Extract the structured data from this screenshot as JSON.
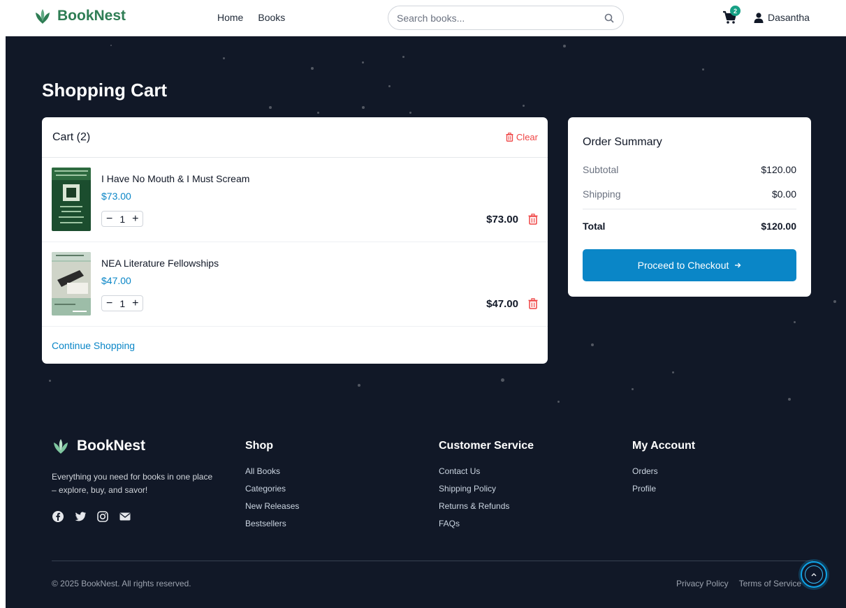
{
  "header": {
    "logo_text": "BookNest",
    "nav": [
      "Home",
      "Books"
    ],
    "search_placeholder": "Search books...",
    "cart_count": "2",
    "username": "Dasantha"
  },
  "page": {
    "title": "Shopping Cart"
  },
  "cart": {
    "heading": "Cart (2)",
    "clear_label": "Clear",
    "items": [
      {
        "title": "I Have No Mouth & I Must Scream",
        "price": "$73.00",
        "quantity": "1",
        "line_total": "$73.00"
      },
      {
        "title": "NEA Literature Fellowships",
        "price": "$47.00",
        "quantity": "1",
        "line_total": "$47.00"
      }
    ],
    "continue_label": "Continue Shopping"
  },
  "summary": {
    "title": "Order Summary",
    "subtotal_label": "Subtotal",
    "subtotal": "$120.00",
    "shipping_label": "Shipping",
    "shipping": "$0.00",
    "total_label": "Total",
    "total": "$120.00",
    "checkout_label": "Proceed to Checkout"
  },
  "footer": {
    "logo_text": "BookNest",
    "tagline": "Everything you need for books in one place – explore, buy, and savor!",
    "social_icons": [
      "facebook-icon",
      "twitter-icon",
      "instagram-icon",
      "envelope-icon"
    ],
    "columns": [
      {
        "title": "Shop",
        "links": [
          "All Books",
          "Categories",
          "New Releases",
          "Bestsellers"
        ]
      },
      {
        "title": "Customer Service",
        "links": [
          "Contact Us",
          "Shipping Policy",
          "Returns & Refunds",
          "FAQs"
        ]
      },
      {
        "title": "My Account",
        "links": [
          "Orders",
          "Profile"
        ]
      }
    ],
    "copyright": "© 2025 BookNest. All rights reserved.",
    "legal": [
      "Privacy Policy",
      "Terms of Service"
    ]
  },
  "colors": {
    "brand_green": "#2e7d54",
    "accent_blue": "#0a86c7",
    "danger_red": "#ef4444",
    "dark_bg": "#111827",
    "badge_teal": "#16a085"
  }
}
